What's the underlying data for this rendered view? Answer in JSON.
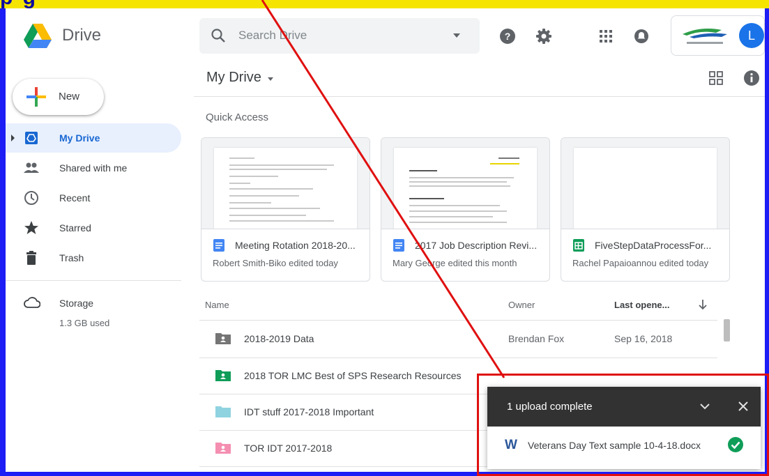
{
  "header": {
    "app_name": "Drive",
    "search_placeholder": "Search Drive",
    "avatar_letter": "L"
  },
  "sidebar": {
    "new_label": "New",
    "items": [
      {
        "label": "My Drive",
        "icon": "my-drive-icon",
        "active": true
      },
      {
        "label": "Shared with me",
        "icon": "people-icon"
      },
      {
        "label": "Recent",
        "icon": "clock-icon"
      },
      {
        "label": "Starred",
        "icon": "star-icon"
      },
      {
        "label": "Trash",
        "icon": "trash-icon"
      }
    ],
    "storage_label": "Storage",
    "storage_used": "1.3 GB used"
  },
  "main": {
    "title": "My Drive",
    "quick_access_title": "Quick Access",
    "quick_access": [
      {
        "name": "Meeting Rotation 2018-20...",
        "subtitle": "Robert Smith-Biko edited today",
        "type": "doc"
      },
      {
        "name": "2017 Job Description Revi...",
        "subtitle": "Mary George edited this month",
        "type": "doc"
      },
      {
        "name": "FiveStepDataProcessFor...",
        "subtitle": "Rachel Papaioannou edited today",
        "type": "sheet"
      }
    ],
    "columns": {
      "name": "Name",
      "owner": "Owner",
      "last_opened": "Last opene..."
    },
    "rows": [
      {
        "name": "2018-2019 Data",
        "owner": "Brendan Fox",
        "date": "Sep 16, 2018",
        "folder_color": "#757575"
      },
      {
        "name": "2018 TOR LMC Best of SPS Research Resources",
        "owner": "",
        "date": "",
        "folder_color": "#0f9d58"
      },
      {
        "name": "IDT stuff 2017-2018 Important",
        "owner": "",
        "date": "",
        "folder_color": "#8fd3e0"
      },
      {
        "name": "TOR IDT 2017-2018",
        "owner": "",
        "date": "",
        "folder_color": "#f48fb1"
      }
    ]
  },
  "upload": {
    "title": "1 upload complete",
    "file_name": "Veterans Day Text sample 10-4-18.docx"
  },
  "colors": {
    "accent": "#1a73e8",
    "toast_header": "#323232",
    "success": "#0f9d58",
    "annotation": "#e01010"
  }
}
